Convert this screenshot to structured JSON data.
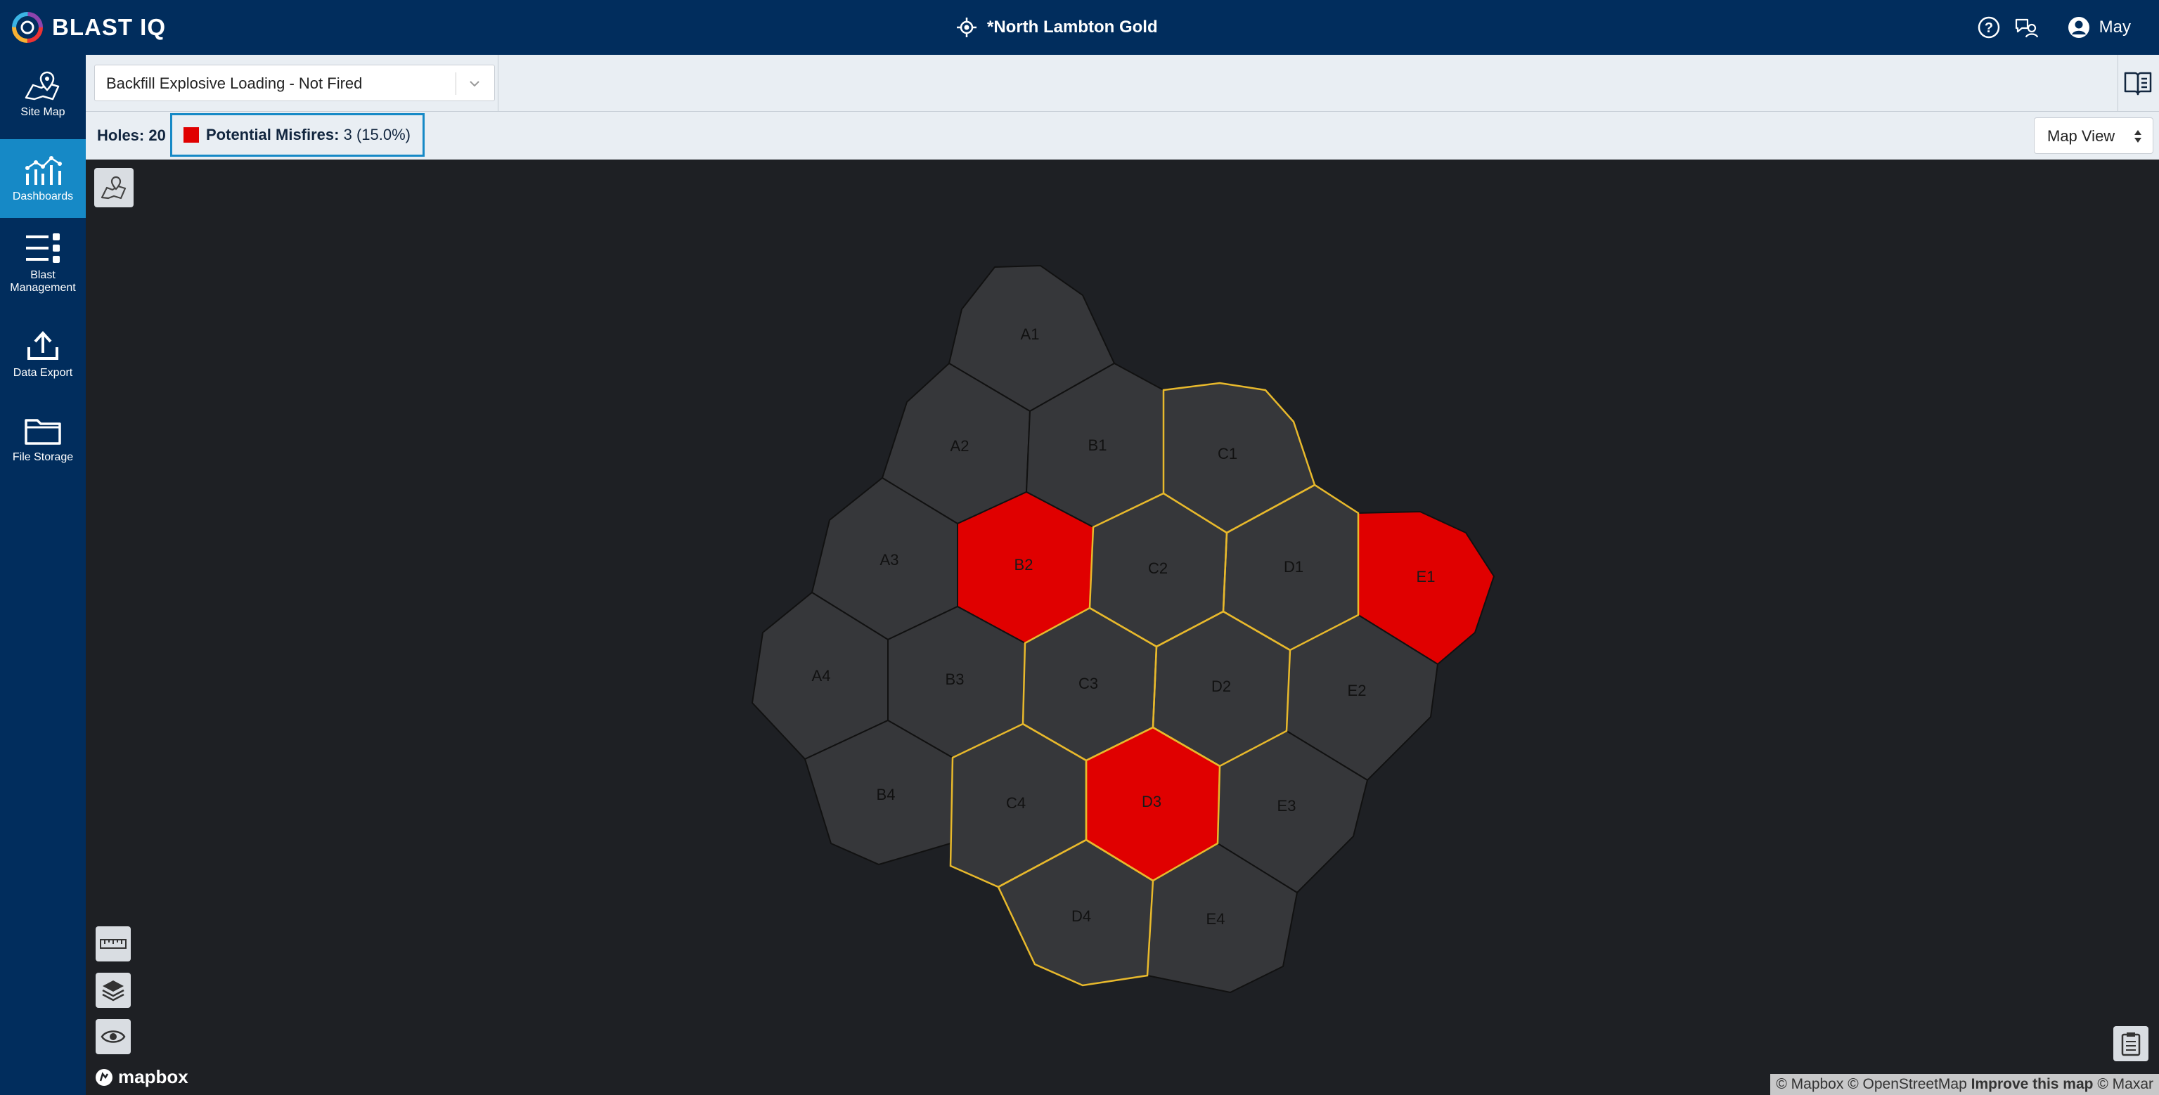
{
  "app": {
    "logo_text": "BLAST IQ",
    "site": "*North Lambton Gold",
    "user": "May"
  },
  "sidebar": {
    "items": [
      {
        "label": "Site Map"
      },
      {
        "label": "Dashboards",
        "active": true
      },
      {
        "label": "Blast Management"
      },
      {
        "label": "Data Export"
      },
      {
        "label": "File Storage"
      }
    ]
  },
  "toolbar": {
    "blast_select": "Backfill Explosive Loading - Not Fired"
  },
  "status": {
    "holes": "Holes: 20",
    "misfire_label": "Potential Misfires:",
    "misfire_value": "3 (15.0%)",
    "misfire_color": "#e00000",
    "view_select": "Map View"
  },
  "map": {
    "holes": [
      {
        "id": "A1",
        "misfire": false
      },
      {
        "id": "A2",
        "misfire": false
      },
      {
        "id": "A3",
        "misfire": false
      },
      {
        "id": "A4",
        "misfire": false
      },
      {
        "id": "B1",
        "misfire": false
      },
      {
        "id": "B2",
        "misfire": true
      },
      {
        "id": "B3",
        "misfire": false
      },
      {
        "id": "B4",
        "misfire": false
      },
      {
        "id": "C1",
        "misfire": false
      },
      {
        "id": "C2",
        "misfire": false
      },
      {
        "id": "C3",
        "misfire": false
      },
      {
        "id": "C4",
        "misfire": false
      },
      {
        "id": "D1",
        "misfire": false
      },
      {
        "id": "D2",
        "misfire": false
      },
      {
        "id": "D3",
        "misfire": true
      },
      {
        "id": "D4",
        "misfire": false
      },
      {
        "id": "E1",
        "misfire": true
      },
      {
        "id": "E2",
        "misfire": false
      },
      {
        "id": "E3",
        "misfire": false
      },
      {
        "id": "E4",
        "misfire": false
      }
    ],
    "cell_color": "#36373a",
    "highlight_color": "#e8b92c",
    "mapbox_logo": "mapbox",
    "attribution": {
      "a": "© Mapbox © OpenStreetMap",
      "b": "Improve this map",
      "c": "© Maxar"
    }
  }
}
